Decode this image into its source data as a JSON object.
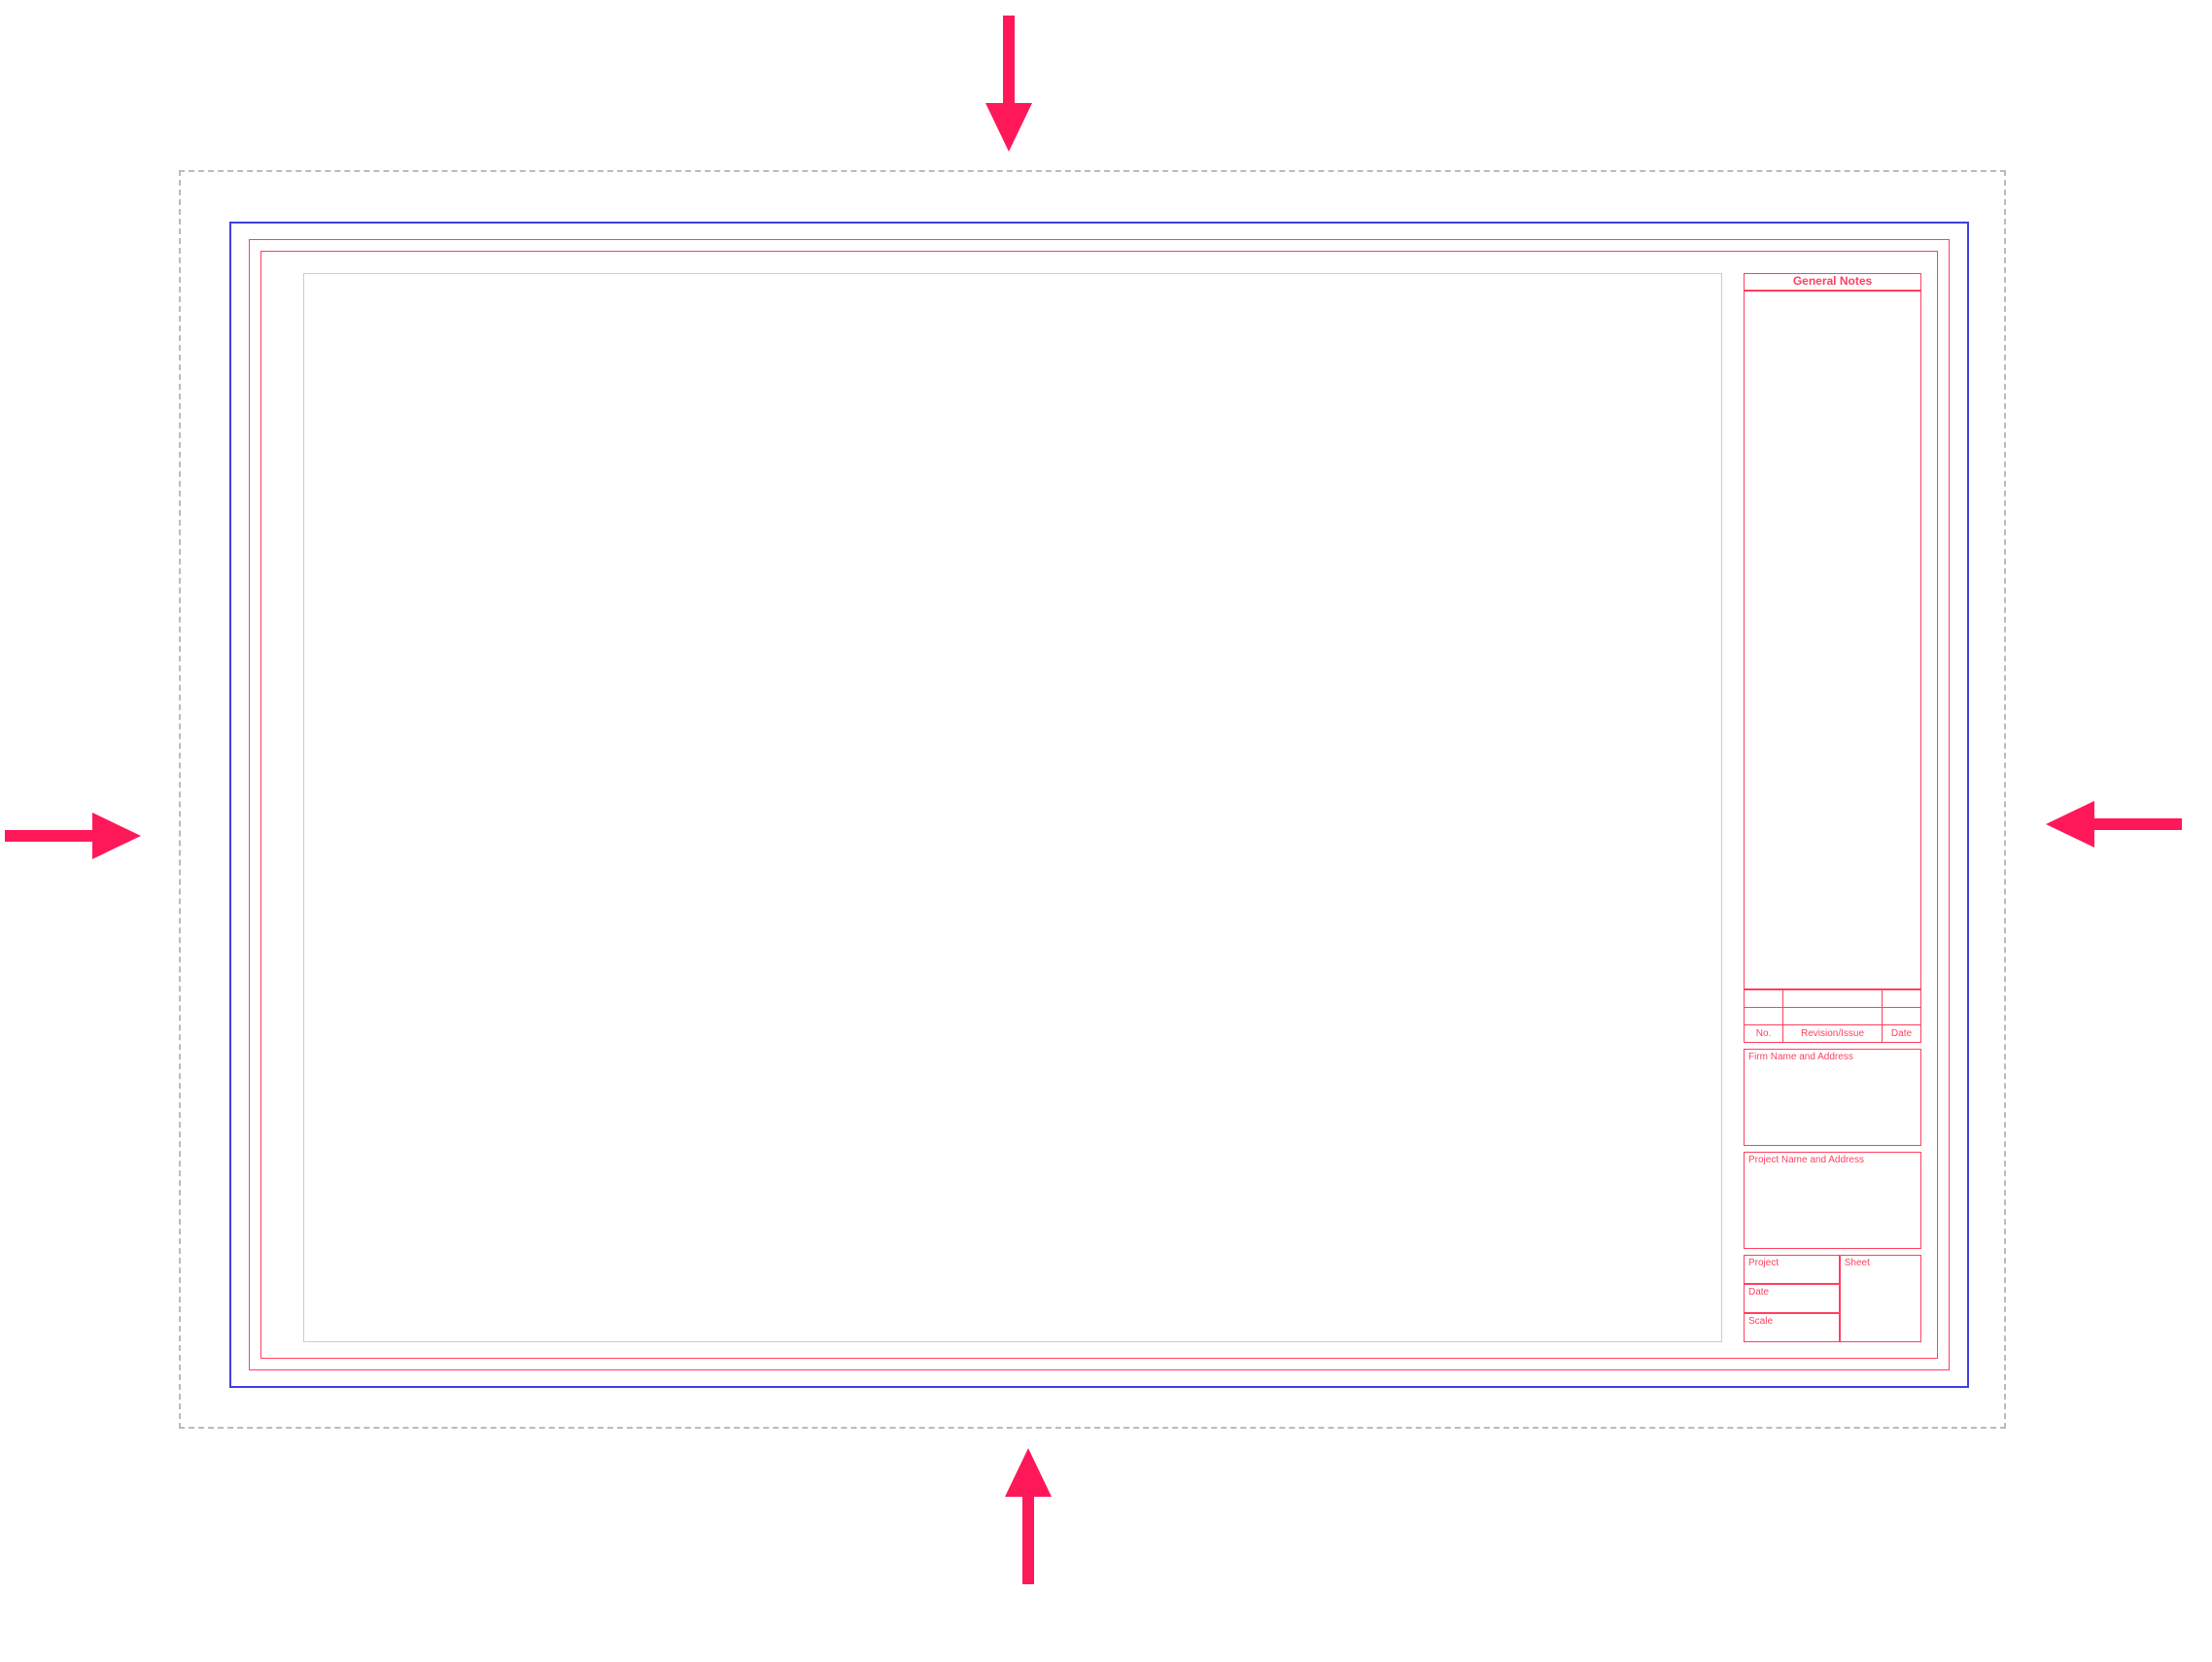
{
  "titleblock": {
    "general_notes_header": "General Notes",
    "rev_no_header": "No.",
    "rev_issue_header": "Revision/Issue",
    "rev_date_header": "Date",
    "firm_label": "Firm Name and Address",
    "project_label": "Project Name and Address",
    "project_field": "Project",
    "sheet_field": "Sheet",
    "date_field": "Date",
    "scale_field": "Scale"
  },
  "colors": {
    "arrow": "#ff1859",
    "blue_border": "#4040e0",
    "red_border": "#ff4060",
    "dashed": "#bbb"
  }
}
